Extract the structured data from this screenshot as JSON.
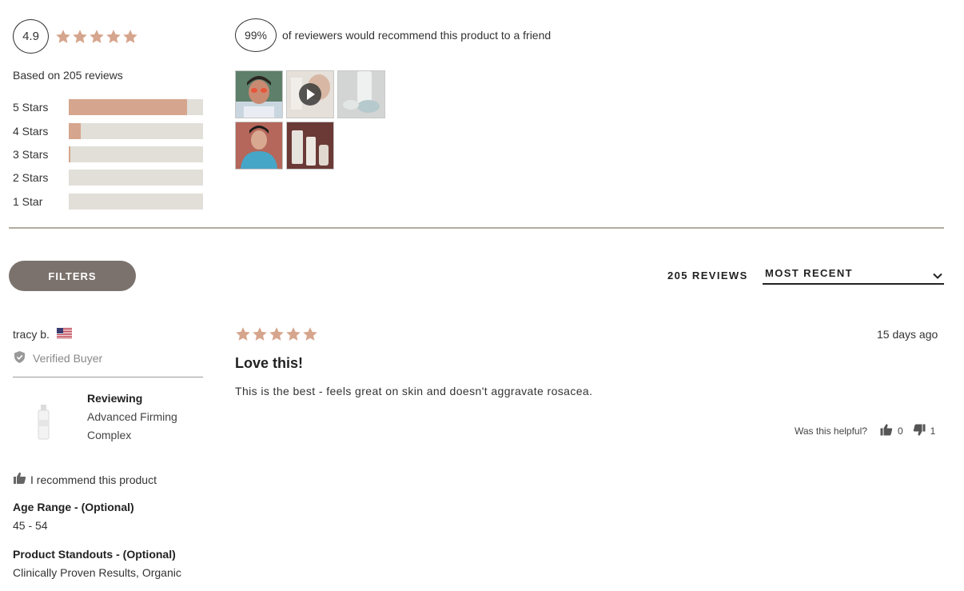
{
  "summary": {
    "average_rating": "4.9",
    "average_stars_filled": 5,
    "based_on": "Based on 205 reviews",
    "distribution": [
      {
        "label": "5 Stars",
        "fraction": 0.88
      },
      {
        "label": "4 Stars",
        "fraction": 0.09
      },
      {
        "label": "3 Stars",
        "fraction": 0.01
      },
      {
        "label": "2 Stars",
        "fraction": 0.0
      },
      {
        "label": "1 Star",
        "fraction": 0.0
      }
    ],
    "recommend_percent": "99%",
    "recommend_text": "of reviewers would recommend this product to a friend"
  },
  "media": {
    "thumbnails": [
      {
        "name": "photo-thumbnail",
        "type": "photo"
      },
      {
        "name": "video-thumbnail",
        "type": "video"
      },
      {
        "name": "photo-thumbnail",
        "type": "photo"
      },
      {
        "name": "photo-thumbnail",
        "type": "photo"
      },
      {
        "name": "photo-thumbnail",
        "type": "photo"
      }
    ]
  },
  "toolbar": {
    "filters_label": "FILTERS",
    "review_count": "205 REVIEWS",
    "sort_value": "MOST RECENT"
  },
  "review": {
    "reviewer_name": "tracy b.",
    "country_flag": "us-flag-icon",
    "verified_label": "Verified Buyer",
    "reviewing_label": "Reviewing",
    "product_name": "Advanced Firming Complex",
    "recommend_label": "I recommend this product",
    "questions": [
      {
        "label": "Age Range - (Optional)",
        "value": "45 - 54"
      },
      {
        "label": "Product Standouts - (Optional)",
        "value": "Clinically Proven Results, Organic"
      }
    ],
    "rating": 5,
    "date": "15 days ago",
    "title": "Love this!",
    "body": "This is the best - feels great on skin and doesn't aggravate rosacea.",
    "helpful_label": "Was this helpful?",
    "helpful_yes": "0",
    "helpful_no": "1"
  },
  "colors": {
    "star": "#d6a58d",
    "bar_fill": "#d6a58d",
    "bar_track": "#e1dfd8",
    "filters_button": "#7b726d",
    "divider": "#b1ad9e"
  }
}
